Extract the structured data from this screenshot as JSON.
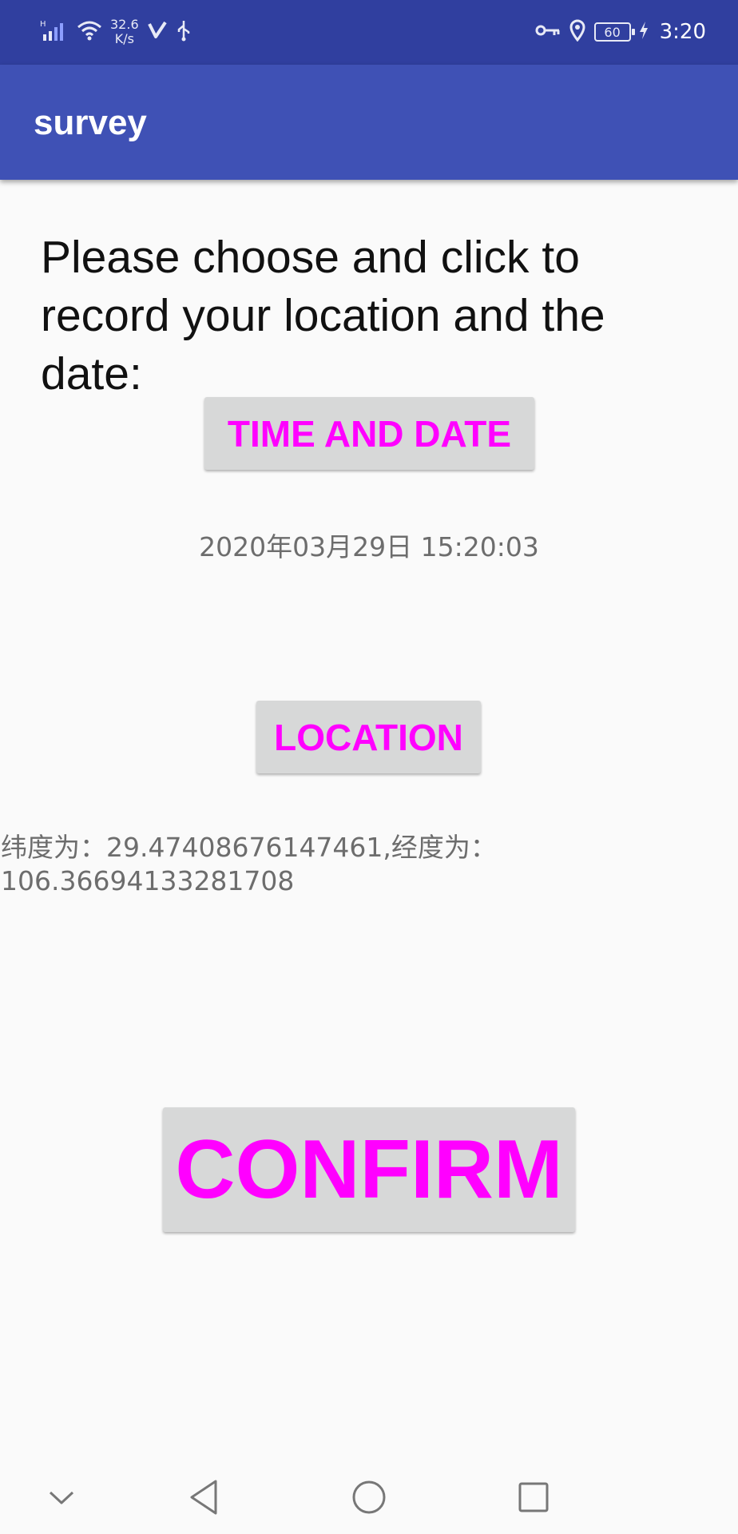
{
  "status_bar": {
    "signal_label": "H",
    "net_speed_value": "32.6",
    "net_speed_unit": "K/s",
    "battery": "60",
    "time": "3:20",
    "icons": [
      "signal-icon",
      "wifi-icon",
      "vpn-check-icon",
      "usb-icon",
      "key-icon",
      "location-pin-icon",
      "battery-icon",
      "charging-icon"
    ]
  },
  "app_bar": {
    "title": "survey"
  },
  "main": {
    "instruction": "Please choose and click to record your location and the date:",
    "time_button_label": "TIME AND DATE",
    "datetime_value": "2020年03月29日 15:20:03",
    "location_button_label": "LOCATION",
    "coords_line1": "纬度为：29.47408676147461,经度为：",
    "coords_line2": "106.36694133281708",
    "confirm_button_label": "CONFIRM"
  },
  "nav_bar": {
    "icons": [
      "chevron-down-icon",
      "back-icon",
      "home-icon",
      "recents-icon"
    ]
  },
  "colors": {
    "status_bar": "#303f9f",
    "app_bar": "#3f51b5",
    "button_text": "#ff00ff",
    "button_bg": "#d7d8d8",
    "secondary_text": "#6d6d6d"
  }
}
